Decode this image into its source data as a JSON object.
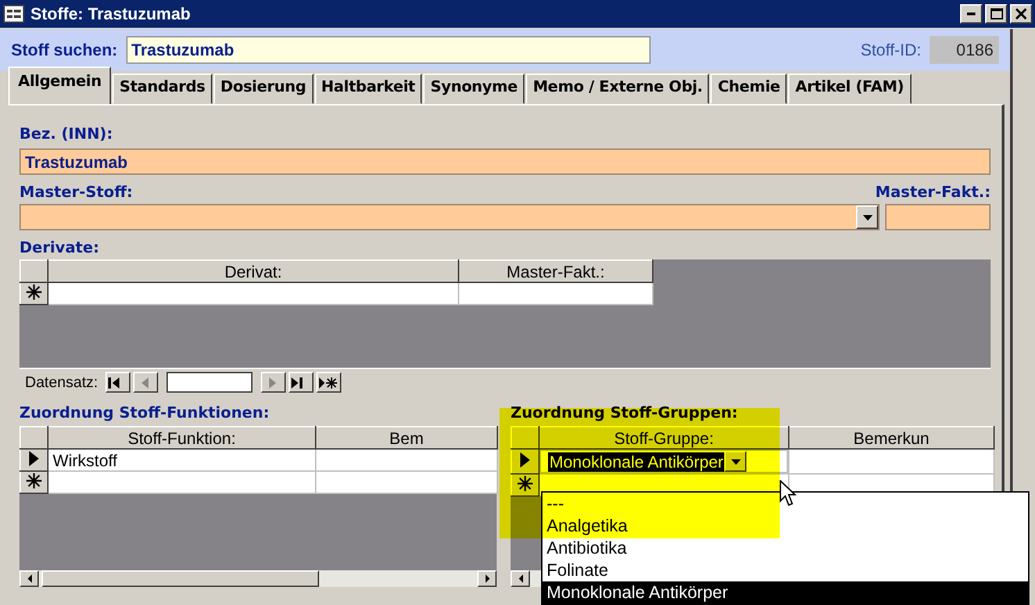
{
  "window": {
    "title": "Stoffe: Trastuzumab"
  },
  "search": {
    "label": "Stoff suchen:",
    "value": "Trastuzumab"
  },
  "stoff_id": {
    "label": "Stoff-ID:",
    "value": "0186"
  },
  "tabs": [
    {
      "label": "Allgemein",
      "selected": true
    },
    {
      "label": "Standards",
      "selected": false
    },
    {
      "label": "Dosierung",
      "selected": false
    },
    {
      "label": "Haltbarkeit",
      "selected": false
    },
    {
      "label": "Synonyme",
      "selected": false
    },
    {
      "label": "Memo / Externe Obj.",
      "selected": false
    },
    {
      "label": "Chemie",
      "selected": false
    },
    {
      "label": "Artikel (FAM)",
      "selected": false
    }
  ],
  "bez": {
    "label": "Bez. (INN):",
    "value": "Trastuzumab"
  },
  "master_stoff": {
    "label": "Master-Stoff:"
  },
  "master_fakt": {
    "label": "Master-Fakt.:"
  },
  "derivate": {
    "label": "Derivate:",
    "columns": [
      "Derivat:",
      "Master-Fakt.:"
    ],
    "rows": [
      {
        "kind": "new",
        "cells": []
      }
    ],
    "nav_label": "Datensatz:"
  },
  "funktionen": {
    "label": "Zuordnung Stoff-Funktionen:",
    "columns": [
      "Stoff-Funktion:",
      "Bem"
    ],
    "rows": [
      {
        "kind": "current",
        "cells": [
          "Wirkstoff"
        ]
      },
      {
        "kind": "new",
        "cells": []
      }
    ]
  },
  "gruppen": {
    "label": "Zuordnung Stoff-Gruppen:",
    "highlighted": true,
    "columns": [
      "Stoff-Gruppe:",
      "Bemerkun"
    ],
    "rows": [
      {
        "kind": "current",
        "cells": [
          "Monoklonale Antikörper"
        ]
      },
      {
        "kind": "new",
        "cells": []
      }
    ],
    "dropdown": {
      "items": [
        {
          "label": "---",
          "selected": false
        },
        {
          "label": "Analgetika",
          "selected": false
        },
        {
          "label": "Antibiotika",
          "selected": false
        },
        {
          "label": "Folinate",
          "selected": false
        },
        {
          "label": "Monoklonale Antikörper",
          "selected": true
        }
      ]
    }
  }
}
